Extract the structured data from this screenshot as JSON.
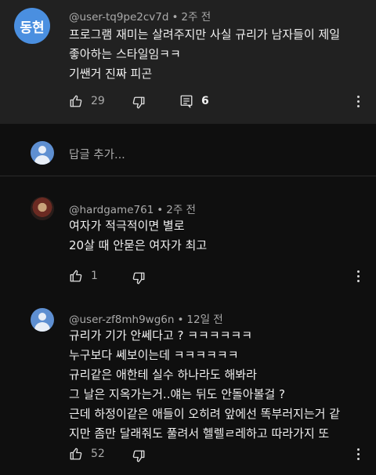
{
  "parent_comment": {
    "avatar_text": "동현",
    "username": "@user-tq9pe2cv7d",
    "time": "2주 전",
    "text": "프로그램 재미는 살려주지만 사실 규리가 남자들이 제일\n좋아하는 스타일임ㅋㅋ\n기쌘거 진짜 피곤",
    "likes": "29",
    "replies": "6"
  },
  "reply_box": {
    "placeholder": "답글 추가..."
  },
  "replies": [
    {
      "username": "@hardgame761",
      "time": "2주 전",
      "text": "여자가 적극적이면 별로\n20살 때 안묻은 여자가 최고",
      "likes": "1"
    },
    {
      "username": "@user-zf8mh9wg6n",
      "time": "12일 전",
      "text": "규리가 기가 안쎄다고 ? ㅋㅋㅋㅋㅋㅋ\n누구보다 쎄보이는데 ㅋㅋㅋㅋㅋㅋ\n규리같은 애한테 실수 하나라도 해봐라\n그 날은 지옥가는거..얘는 뒤도 안돌아볼걸 ?\n근데 하정이같은 애들이 오히려 앞에선 똑부러지는거 같\n지만 좀만 달래줘도 풀려서 헬렐ㄹ레하고 따라가지 또",
      "likes": "52"
    }
  ],
  "icons": {
    "like": "thumbs-up-icon",
    "dislike": "thumbs-down-icon",
    "replies": "comment-reply-icon",
    "more": "more-vert-icon"
  }
}
